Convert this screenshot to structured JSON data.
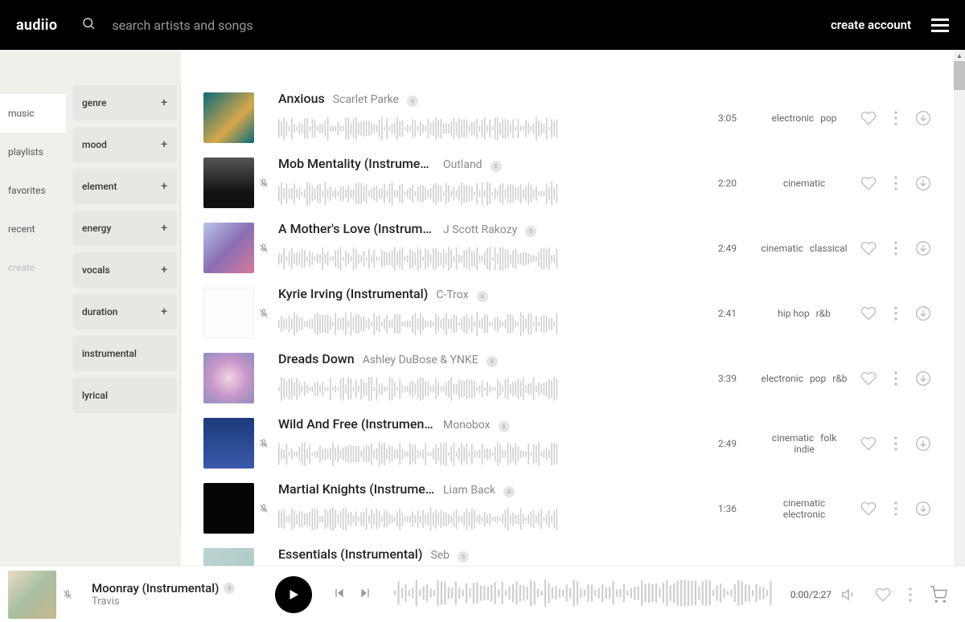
{
  "header": {
    "logo": "audiio",
    "search_placeholder": "search artists and songs",
    "create_account": "create account"
  },
  "sidebar": {
    "items": [
      {
        "label": "music",
        "active": true
      },
      {
        "label": "playlists"
      },
      {
        "label": "favorites"
      },
      {
        "label": "recent"
      },
      {
        "label": "create",
        "muted": true
      }
    ]
  },
  "filters": [
    {
      "label": "genre",
      "expandable": true
    },
    {
      "label": "mood",
      "expandable": true
    },
    {
      "label": "element",
      "expandable": true
    },
    {
      "label": "energy",
      "expandable": true
    },
    {
      "label": "vocals",
      "expandable": true
    },
    {
      "label": "duration",
      "expandable": true
    },
    {
      "label": "instrumental",
      "expandable": false
    },
    {
      "label": "lyrical",
      "expandable": false
    }
  ],
  "tracks": [
    {
      "title": "Anxious",
      "artist": "Scarlet Parke",
      "duration": "3:05",
      "tags": [
        "electronic",
        "pop"
      ],
      "instrumental": false,
      "art": "art0"
    },
    {
      "title": "Mob Mentality (Instrumental)",
      "artist": "Outland",
      "duration": "2:20",
      "tags": [
        "cinematic"
      ],
      "instrumental": true,
      "art": "art1"
    },
    {
      "title": "A Mother's Love (Instrumen…",
      "artist": "J Scott Rakozy",
      "duration": "2:49",
      "tags": [
        "cinematic",
        "classical"
      ],
      "instrumental": true,
      "art": "art2"
    },
    {
      "title": "Kyrie Irving (Instrumental)",
      "artist": "C-Trox",
      "duration": "2:41",
      "tags": [
        "hip hop",
        "r&b"
      ],
      "instrumental": true,
      "art": "art3"
    },
    {
      "title": "Dreads Down",
      "artist": "Ashley DuBose & YNKE",
      "duration": "3:39",
      "tags": [
        "electronic",
        "pop",
        "r&b"
      ],
      "instrumental": false,
      "art": "art4"
    },
    {
      "title": "Wild And Free (Instrumental)",
      "artist": "Monobox",
      "duration": "2:49",
      "tags": [
        "cinematic",
        "folk",
        "indie"
      ],
      "instrumental": true,
      "art": "art5"
    },
    {
      "title": "Martial Knights (Instrumental)",
      "artist": "Liam Back",
      "duration": "1:36",
      "tags": [
        "cinematic",
        "electronic"
      ],
      "instrumental": true,
      "art": "art6"
    },
    {
      "title": "Essentials (Instrumental)",
      "artist": "Seb",
      "duration": "",
      "tags": [],
      "instrumental": true,
      "art": "art7"
    }
  ],
  "player": {
    "title": "Moonray (Instrumental)",
    "artist": "Travis",
    "time": "0:00/2:27",
    "instrumental": true
  }
}
